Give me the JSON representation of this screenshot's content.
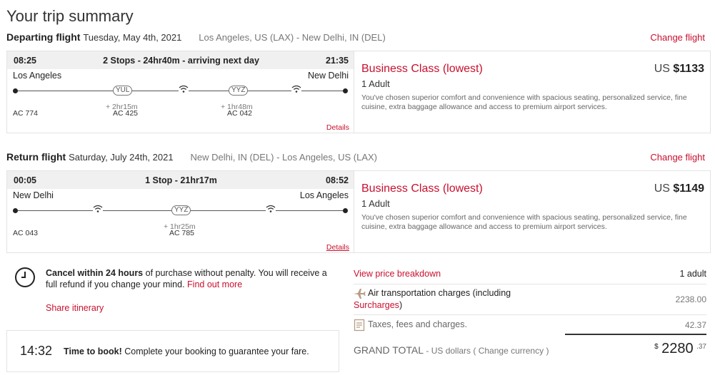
{
  "page": {
    "title": "Your trip summary"
  },
  "departing": {
    "label": "Departing flight",
    "date": "Tuesday, May 4th, 2021",
    "route": "Los Angeles, US (LAX) - New Delhi, IN (DEL)",
    "change_link": "Change flight",
    "depart_time": "08:25",
    "summary": "2 Stops - 24hr40m - arriving next day",
    "arrive_time": "21:35",
    "origin_city": "Los Angeles",
    "dest_city": "New Delhi",
    "stops": [
      {
        "code": "YUL",
        "layover": "+ 2hr15m"
      },
      {
        "code": "YYZ",
        "layover": "+ 1hr48m"
      }
    ],
    "flight_numbers": [
      "AC 774",
      "AC 425",
      "AC 042"
    ],
    "details_link": "Details",
    "fare": {
      "name": "Business Class (lowest)",
      "currency": "US",
      "price": "$1133",
      "pax": "1 Adult",
      "description": "You've chosen superior comfort and convenience with spacious seating, personalized service, fine cuisine, extra baggage allowance and access to premium airport services."
    }
  },
  "return": {
    "label": "Return flight",
    "date": "Saturday, July 24th, 2021",
    "route": "New Delhi, IN (DEL) - Los Angeles, US (LAX)",
    "change_link": "Change flight",
    "depart_time": "00:05",
    "summary": "1 Stop - 21hr17m",
    "arrive_time": "08:52",
    "origin_city": "New Delhi",
    "dest_city": "Los Angeles",
    "stops": [
      {
        "code": "YYZ",
        "layover": "+ 1hr25m"
      }
    ],
    "flight_numbers": [
      "AC 043",
      "AC 785"
    ],
    "details_link": "Details",
    "fare": {
      "name": "Business Class (lowest)",
      "currency": "US",
      "price": "$1149",
      "pax": "1 Adult",
      "description": "You've chosen superior comfort and convenience with spacious seating, personalized service, fine cuisine, extra baggage allowance and access to premium airport services."
    }
  },
  "cancel": {
    "bold": "Cancel within 24 hours",
    "text": " of purchase without penalty. You will receive a full refund if you change your mind. ",
    "link": "Find out more"
  },
  "share_link": "Share itinerary",
  "timer": {
    "time": "14:32",
    "bold": "Time to book!",
    "text": " Complete your booking to guarantee your fare."
  },
  "breakdown": {
    "link": "View price breakdown",
    "pax": "1 adult",
    "air_label_1": "Air transportation charges (including",
    "air_label_2": "Surcharges",
    "air_label_3": ")",
    "air_amount": "2238.00",
    "tax_label": "Taxes, fees and charges.",
    "tax_amount": "42.37",
    "grand_label": "GRAND TOTAL",
    "grand_sub_1": " - US dollars ( ",
    "grand_sub_link": "Change currency",
    "grand_sub_2": " )",
    "grand_currency": "$",
    "grand_whole": "2280",
    "grand_cents": ".37"
  },
  "colors": {
    "accent": "#c8102e",
    "header_bg": "#f0f0f0",
    "border": "#e3e3e3"
  }
}
